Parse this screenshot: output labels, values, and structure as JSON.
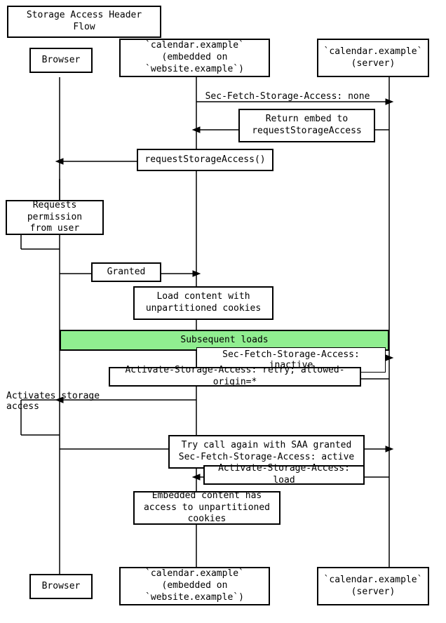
{
  "title": "Storage Access Header Flow",
  "boxes": {
    "title": "Storage Access Header Flow",
    "browser_top": "Browser",
    "embed_top": "`calendar.example`\n(embedded on `website.example`)",
    "server_top": "`calendar.example`\n(server)",
    "sec_fetch_none": "Sec-Fetch-Storage-Access: none",
    "return_embed": "Return embed to\nrequestStorageAccess",
    "request_storage": "requestStorageAccess()",
    "requests_permission": "Requests permission\nfrom user",
    "granted": "Granted",
    "load_content": "Load content with\nunpartitioned cookies",
    "subsequent_loads": "Subsequent loads",
    "sec_fetch_inactive": "Sec-Fetch-Storage-Access: inactive",
    "activate_retry": "Activate-Storage-Access: retry; allowed-origin=*",
    "activates_storage": "Activates storage access",
    "try_call_again": "Try call again with SAA granted\nSec-Fetch-Storage-Access: active",
    "activate_load": "Activate-Storage-Access: load",
    "embedded_content": "Embedded content has\naccess to unpartitioned cookies",
    "browser_bottom": "Browser",
    "embed_bottom": "`calendar.example`\n(embedded on `website.example`)",
    "server_bottom": "`calendar.example`\n(server)"
  }
}
